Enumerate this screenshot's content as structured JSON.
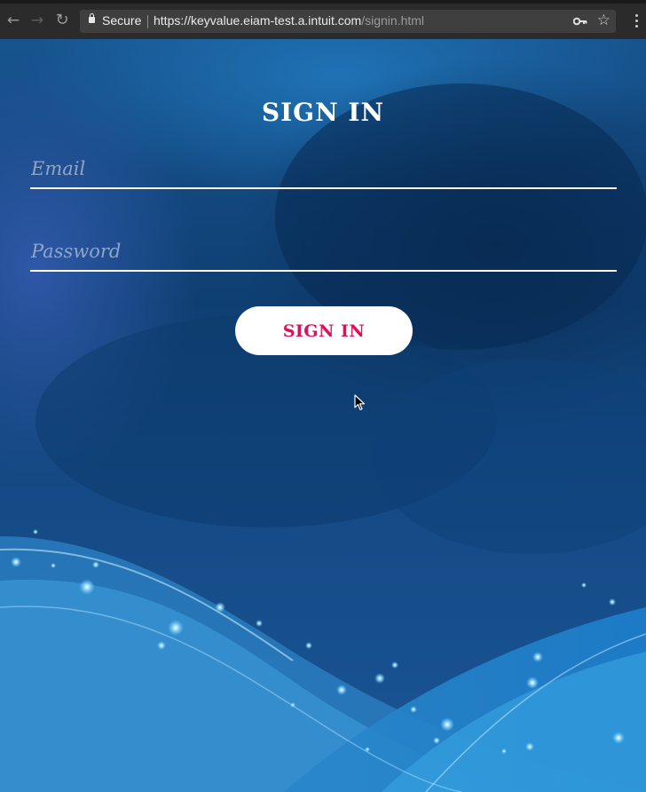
{
  "browser": {
    "secure_label": "Secure",
    "url_host": "https://keyvalue.eiam-test.a.intuit.com",
    "url_path": "/signin.html",
    "icons": [
      "back-arrow-icon",
      "forward-arrow-icon",
      "reload-icon",
      "lock-icon",
      "key-icon",
      "star-icon",
      "menu-icon"
    ]
  },
  "signin": {
    "title": "SIGN IN",
    "email_placeholder": "Email",
    "email_value": "",
    "password_placeholder": "Password",
    "password_value": "",
    "button_label": "SIGN IN"
  },
  "colors": {
    "button_text": "#d8125b",
    "button_bg": "#ffffff",
    "background_deep": "#0b3a66",
    "background_light": "#1f8fd6"
  }
}
